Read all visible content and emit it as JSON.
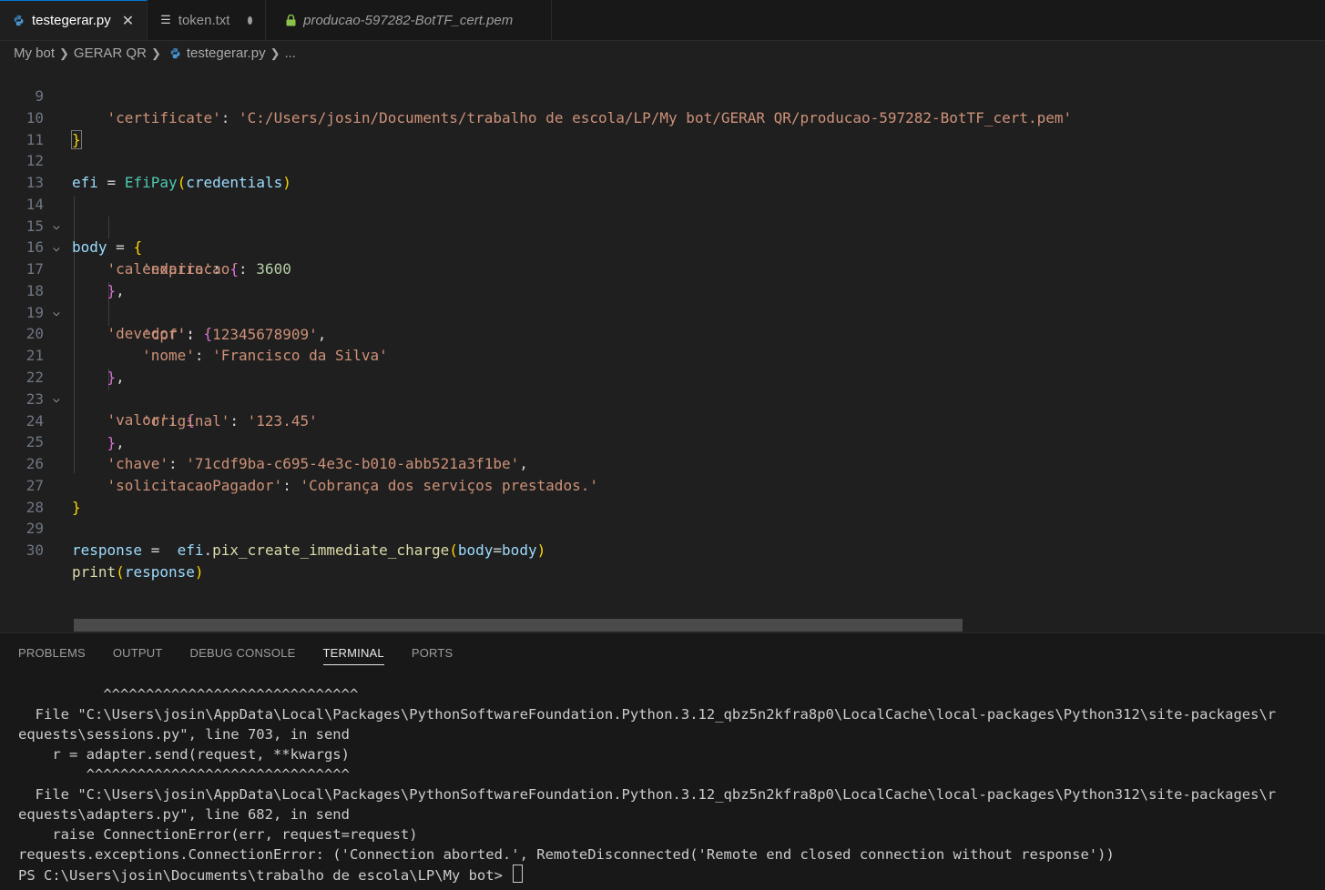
{
  "tabs": [
    {
      "label": "testegerar.py",
      "icon": "python-icon",
      "active": true,
      "close": "✕"
    },
    {
      "label": "token.txt",
      "icon": "text-file-icon",
      "modified": true
    },
    {
      "label": "producao-597282-BotTF_cert.pem",
      "icon": "lock-icon"
    }
  ],
  "breadcrumb": {
    "items": [
      "My bot",
      "GERAR QR",
      "testegerar.py",
      "..."
    ]
  },
  "editor": {
    "lines": [
      {
        "n": "9",
        "code": "certificate"
      },
      {
        "n": "10"
      },
      {
        "n": "11"
      },
      {
        "n": "12"
      },
      {
        "n": "13"
      },
      {
        "n": "14"
      },
      {
        "n": "15"
      },
      {
        "n": "16"
      },
      {
        "n": "17"
      },
      {
        "n": "18"
      },
      {
        "n": "19"
      },
      {
        "n": "20"
      },
      {
        "n": "21"
      },
      {
        "n": "22"
      },
      {
        "n": "23"
      },
      {
        "n": "24"
      },
      {
        "n": "25"
      },
      {
        "n": "26"
      },
      {
        "n": "27"
      },
      {
        "n": "28"
      },
      {
        "n": "29"
      },
      {
        "n": "30"
      }
    ],
    "tokens": {
      "certificate_key": "'certificate'",
      "certificate_val": "'C:/Users/josin/Documents/trabalho de escola/LP/My bot/GERAR QR/producao-597282-BotTF_cert.pem'",
      "efi": "efi",
      "EfiPay": "EfiPay",
      "credentials": "credentials",
      "body": "body",
      "calendario": "'calendario'",
      "expiracao": "'expiracao'",
      "expiracao_val": "3600",
      "devedor": "'devedor'",
      "cpf": "'cpf'",
      "cpf_val": "'12345678909'",
      "nome": "'nome'",
      "nome_val": "'Francisco da Silva'",
      "valor": "'valor'",
      "original": "'original'",
      "original_val": "'123.45'",
      "chave": "'chave'",
      "chave_val": "'71cdf9ba-c695-4e3c-b010-abb521a3f1be'",
      "solicitacao": "'solicitacaoPagador'",
      "solicitacao_val": "'Cobrança dos serviços prestados.'",
      "response": "response",
      "pix_fn": "pix_create_immediate_charge",
      "body_kw": "body",
      "print": "print"
    }
  },
  "panel": {
    "tabs": [
      "PROBLEMS",
      "OUTPUT",
      "DEBUG CONSOLE",
      "TERMINAL",
      "PORTS"
    ],
    "active": "TERMINAL",
    "terminal_lines": [
      "          ^^^^^^^^^^^^^^^^^^^^^^^^^^^^^^",
      "  File \"C:\\Users\\josin\\AppData\\Local\\Packages\\PythonSoftwareFoundation.Python.3.12_qbz5n2kfra8p0\\LocalCache\\local-packages\\Python312\\site-packages\\r",
      "equests\\sessions.py\", line 703, in send",
      "    r = adapter.send(request, **kwargs)",
      "        ^^^^^^^^^^^^^^^^^^^^^^^^^^^^^^^",
      "  File \"C:\\Users\\josin\\AppData\\Local\\Packages\\PythonSoftwareFoundation.Python.3.12_qbz5n2kfra8p0\\LocalCache\\local-packages\\Python312\\site-packages\\r",
      "equests\\adapters.py\", line 682, in send",
      "    raise ConnectionError(err, request=request)",
      "requests.exceptions.ConnectionError: ('Connection aborted.', RemoteDisconnected('Remote end closed connection without response'))"
    ],
    "prompt": "PS C:\\Users\\josin\\Documents\\trabalho de escola\\LP\\My bot> "
  }
}
